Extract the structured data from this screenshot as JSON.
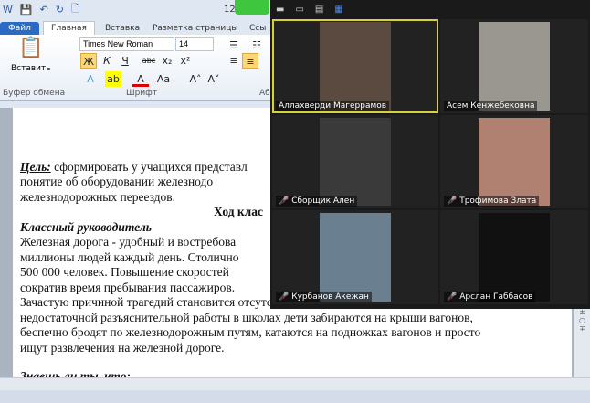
{
  "word": {
    "qat_time": "12",
    "tabs": [
      {
        "label": "Файл"
      },
      {
        "label": "Главная"
      },
      {
        "label": "Вставка"
      },
      {
        "label": "Разметка страницы"
      },
      {
        "label": "Ссы"
      }
    ],
    "font_name": "Times New Roman",
    "font_size": "14",
    "paste_label": "Вставить",
    "group_clipboard": "Буфер обмена",
    "group_font": "Шрифт",
    "group_para": "Аб",
    "format_buttons": {
      "bold": "Ж",
      "italic": "К",
      "underline": "Ч",
      "strike": "abc",
      "sub": "x₂",
      "sup": "x²",
      "case": "Aa",
      "grow": "A˄",
      "shrink": "A˅"
    },
    "doc": {
      "title": "«Правила поведения",
      "goal_label": "Цель:",
      "goal_text": " сформировать у учащихся представл",
      "line2": "понятие об оборудовании железнодо",
      "line3": "железнодорожных переездов.",
      "heading": "Ход клас",
      "teacher": "Классный руководитель",
      "p1": [
        " Железная дорога - удобный и востребова",
        "миллионы людей каждый день. Столично",
        "500 000 человек. Повышение скоростей",
        "сократив время пребывания пассажиров."
      ],
      "p2": [
        "Зачастую причиной трагедий становится отсутствии контроля со стороны родителей и",
        "недостаточной разъяснительной работы в школах дети забираются на крыши вагонов,",
        "беспечно бродят по железнодорожным путям, катаются на подножках вагонов и просто",
        "ищут развлечения на железной дороге."
      ],
      "subheading": "Знаешь ли ты, что:"
    }
  },
  "zoom": {
    "participants": [
      {
        "name": "Аллахверди  Магеррамов",
        "muted": false,
        "active": true,
        "color": "#5a4a40"
      },
      {
        "name": "Асем Кенжебековна",
        "muted": false,
        "active": false,
        "color": "#9a9690"
      },
      {
        "name": "Сборщик Ален",
        "muted": true,
        "active": false,
        "color": "#3a3a3a"
      },
      {
        "name": "Трофимова Злата",
        "muted": true,
        "active": false,
        "color": "#b08070"
      },
      {
        "name": "Курбанов Акежан",
        "muted": true,
        "active": false,
        "color": "#6a7f90"
      },
      {
        "name": "Арслан Габбасов",
        "muted": true,
        "active": false,
        "color": "#111111"
      }
    ]
  }
}
